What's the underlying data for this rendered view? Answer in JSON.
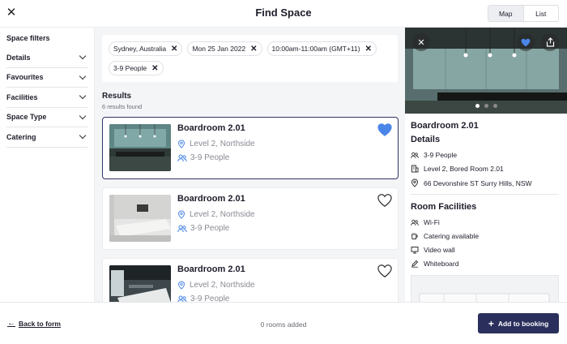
{
  "header": {
    "close_icon": "close-icon",
    "title": "Find Space",
    "view_toggle": {
      "map_label": "Map",
      "list_label": "List",
      "active": "Map"
    }
  },
  "filters": {
    "title": "Space filters",
    "items": [
      {
        "label": "Details"
      },
      {
        "label": "Favourites"
      },
      {
        "label": "Facilities"
      },
      {
        "label": "Space Type"
      },
      {
        "label": "Catering"
      }
    ]
  },
  "chips": [
    {
      "label": "Sydney, Australia"
    },
    {
      "label": "Mon 25 Jan 2022"
    },
    {
      "label": "10:00am-11:00am (GMT+11)"
    },
    {
      "label": "3-9 People"
    }
  ],
  "results": {
    "title": "Results",
    "count": "6 results found",
    "cards": [
      {
        "name": "Boardroom 2.01",
        "location": "Level 2, Northside",
        "capacity": "3-9 People",
        "favourite": true,
        "selected": true
      },
      {
        "name": "Boardroom 2.01",
        "location": "Level 2, Northside",
        "capacity": "3-9 People",
        "favourite": false,
        "selected": false
      },
      {
        "name": "Boardroom 2.01",
        "location": "Level 2, Northside",
        "capacity": "3-9 People",
        "favourite": false,
        "selected": false
      }
    ]
  },
  "details": {
    "name": "Boardroom 2.01",
    "details_heading": "Details",
    "capacity": "3-9 People",
    "room": "Level 2, Bored Room 2.01",
    "address": "66 Devonshire ST Surry Hills, NSW",
    "facilities_heading": "Room Facilities",
    "facilities": [
      {
        "label": "Wi-Fi",
        "icon": "people-icon"
      },
      {
        "label": "Catering available",
        "icon": "coffee-icon"
      },
      {
        "label": "Video wall",
        "icon": "monitor-icon"
      },
      {
        "label": "Whiteboard",
        "icon": "pen-icon"
      }
    ],
    "carousel": {
      "count": 3,
      "active": 0
    }
  },
  "footer": {
    "back_label": "Back to form",
    "rooms_added": "0 rooms added",
    "add_label": "Add to booking"
  },
  "colors": {
    "primary": "#2a2f5c",
    "heart_filled": "#4a86e8",
    "background": "#f4f5f7"
  }
}
